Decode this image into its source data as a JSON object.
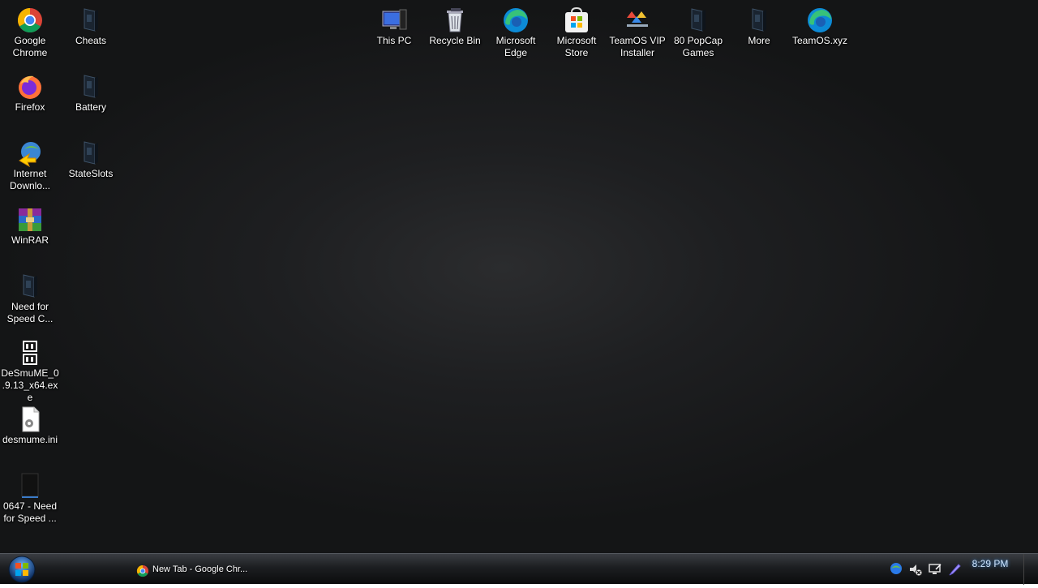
{
  "desktop": {
    "icons": [
      {
        "label": "Google Chrome",
        "icon": "chrome-icon"
      },
      {
        "label": "Cheats",
        "icon": "folder-icon"
      },
      {
        "label": "Firefox",
        "icon": "firefox-icon"
      },
      {
        "label": "Battery",
        "icon": "folder-icon"
      },
      {
        "label": "Internet Downlo...",
        "icon": "idm-icon"
      },
      {
        "label": "StateSlots",
        "icon": "folder-icon"
      },
      {
        "label": "WinRAR",
        "icon": "winrar-icon"
      },
      {
        "label": "Need for Speed C...",
        "icon": "folder-icon"
      },
      {
        "label": "DeSmuME_0.9.13_x64.exe",
        "icon": "desmume-icon"
      },
      {
        "label": "desmume.ini",
        "icon": "ini-file-icon"
      },
      {
        "label": "0647 - Need for Speed ...",
        "icon": "rom-file-icon"
      },
      {
        "label": "This PC",
        "icon": "this-pc-icon"
      },
      {
        "label": "Recycle Bin",
        "icon": "recycle-bin-icon"
      },
      {
        "label": "Microsoft Edge",
        "icon": "edge-icon"
      },
      {
        "label": "Microsoft Store",
        "icon": "store-icon"
      },
      {
        "label": "TeamOS VIP Installer",
        "icon": "teamos-icon"
      },
      {
        "label": "80 PopCap Games",
        "icon": "folder-icon"
      },
      {
        "label": "More",
        "icon": "folder-icon"
      },
      {
        "label": "TeamOS.xyz",
        "icon": "edge-icon"
      }
    ]
  },
  "taskbar": {
    "start_icon": "windows-orb-icon",
    "open_window": {
      "label": "New Tab - Google Chr...",
      "icon": "chrome-icon"
    },
    "tray_icons": [
      "network-green-icon",
      "volume-muted-icon",
      "network-monitor-icon",
      "pen-icon"
    ],
    "clock": "8:29 PM"
  },
  "colors": {
    "desktop_bg": "#1e1f21",
    "taskbar_bg": "#1c1e21",
    "clock_text": "#cfe6ff"
  }
}
